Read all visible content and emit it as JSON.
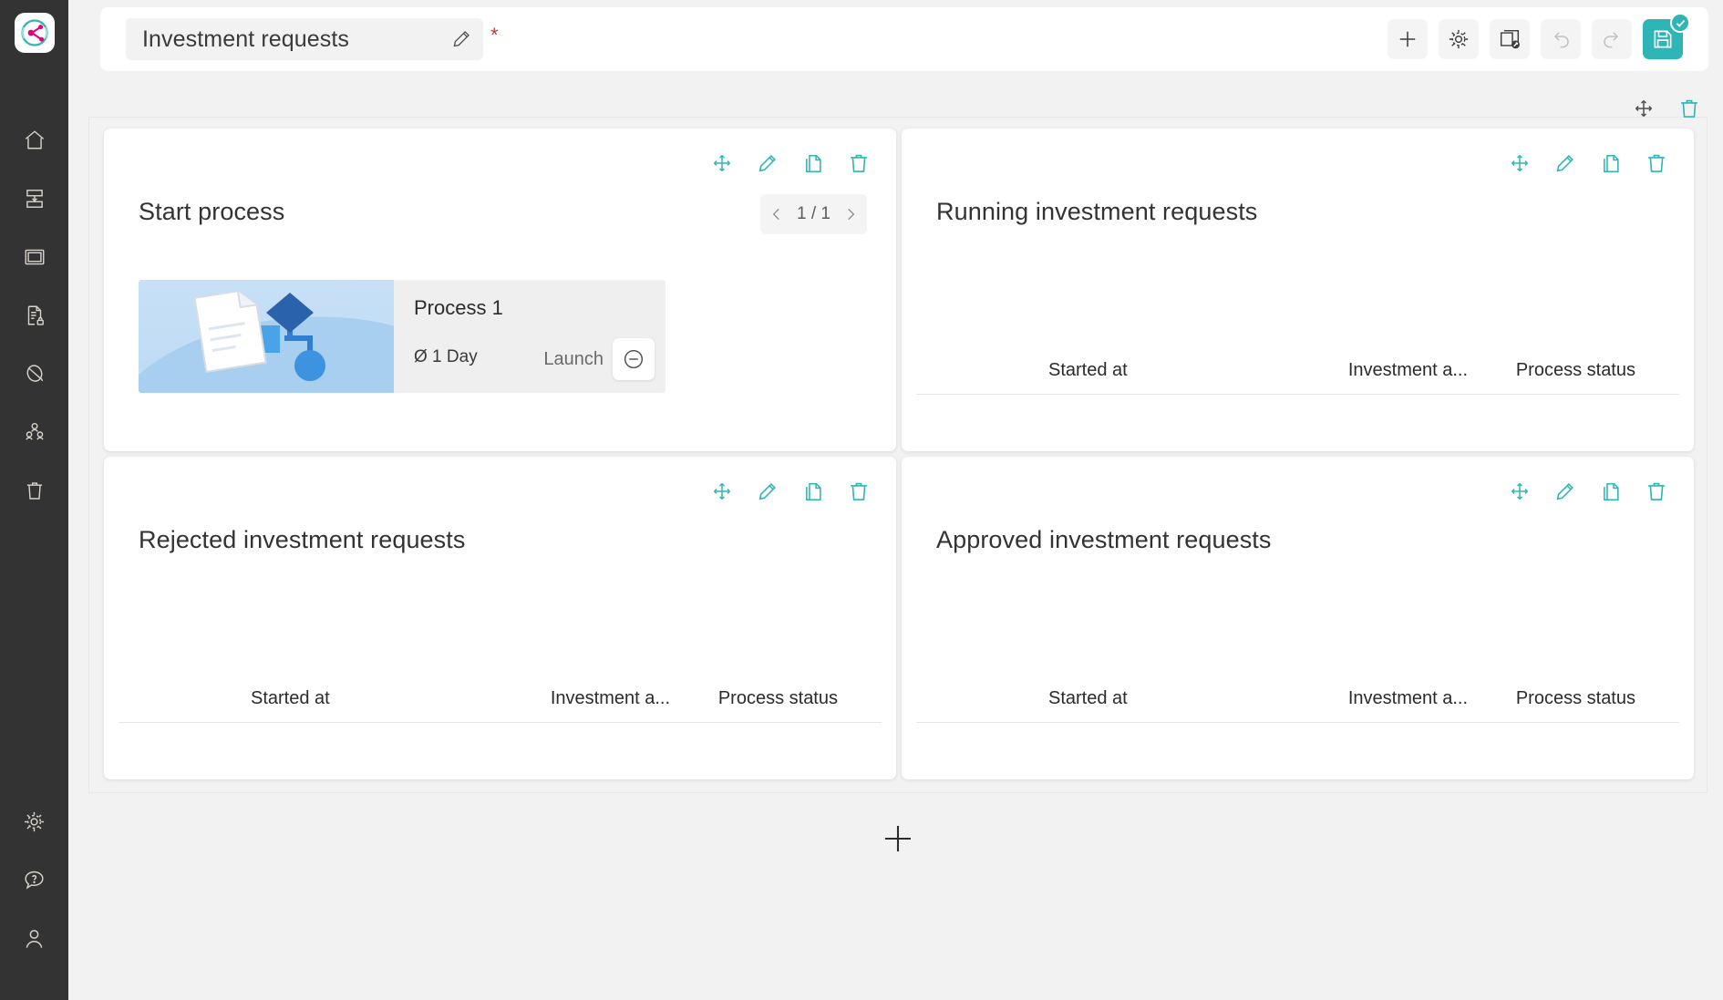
{
  "app": {
    "logo_icon": "app-logo-icon"
  },
  "sidebar": {
    "top_items": [
      {
        "icon": "home-icon",
        "name": "sidebar-item-home"
      },
      {
        "icon": "process-import-icon",
        "name": "sidebar-item-processes"
      },
      {
        "icon": "window-icon",
        "name": "sidebar-item-applications"
      },
      {
        "icon": "document-lock-icon",
        "name": "sidebar-item-documents"
      },
      {
        "icon": "tag-icon",
        "name": "sidebar-item-tags"
      },
      {
        "icon": "users-group-icon",
        "name": "sidebar-item-organization"
      },
      {
        "icon": "trash-icon",
        "name": "sidebar-item-recycle-bin"
      }
    ],
    "bottom_items": [
      {
        "icon": "gear-icon",
        "name": "sidebar-item-settings"
      },
      {
        "icon": "help-bubble-icon",
        "name": "sidebar-item-help"
      },
      {
        "icon": "user-icon",
        "name": "sidebar-item-account"
      }
    ]
  },
  "header": {
    "title_value": "Investment requests",
    "title_placeholder": "Investment requests",
    "edit_icon": "pencil-icon",
    "required_marker": "*",
    "toolbar": [
      {
        "name": "add-button",
        "icon": "plus-icon",
        "label": "Add",
        "disabled": false
      },
      {
        "name": "settings-button",
        "icon": "gear-icon",
        "label": "Settings",
        "disabled": false
      },
      {
        "name": "preview-button",
        "icon": "preview-window-icon",
        "label": "Preview",
        "disabled": false
      },
      {
        "name": "undo-button",
        "icon": "undo-icon",
        "label": "Undo",
        "disabled": true
      },
      {
        "name": "redo-button",
        "icon": "redo-icon",
        "label": "Redo",
        "disabled": true
      },
      {
        "name": "save-button",
        "icon": "save-disk-icon",
        "label": "Save",
        "disabled": false
      }
    ]
  },
  "canvas": {
    "tools": [
      {
        "name": "move-section-button",
        "icon": "move-arrows-icon"
      },
      {
        "name": "delete-section-button",
        "icon": "trash-icon"
      }
    ],
    "card_tools": [
      {
        "name": "move-widget-button",
        "icon": "move-arrows-icon"
      },
      {
        "name": "edit-widget-button",
        "icon": "pencil-icon"
      },
      {
        "name": "duplicate-widget-button",
        "icon": "copy-icon"
      },
      {
        "name": "delete-widget-button",
        "icon": "trash-icon"
      }
    ],
    "add_section": {
      "name": "add-section-button",
      "icon": "plus-icon"
    }
  },
  "colors": {
    "accent_teal": "#2fb5b5",
    "rail_bg": "#333333",
    "page_bg": "#f2f2f2",
    "required_red": "#d0342c",
    "brand_pink": "#e6007e",
    "brand_teal": "#2fb5b5"
  },
  "cards": {
    "start_process": {
      "title": "Start process",
      "pager": {
        "prev_icon": "chevron-left-icon",
        "label": "1 / 1",
        "next_icon": "chevron-right-icon"
      },
      "process": {
        "name": "Process 1",
        "duration": "Ø 1 Day",
        "launch_label": "Launch",
        "launch_icon": "minus-circle-icon",
        "thumbnail_icon": "process-diagram-thumbnail"
      }
    },
    "running": {
      "title": "Running investment requests",
      "columns": [
        "Started at",
        "Investment a...",
        "Process status"
      ],
      "rows": []
    },
    "rejected": {
      "title": "Rejected investment requests",
      "columns": [
        "Started at",
        "Investment a...",
        "Process status"
      ],
      "rows": []
    },
    "approved": {
      "title": "Approved investment requests",
      "columns": [
        "Started at",
        "Investment a...",
        "Process status"
      ],
      "rows": []
    }
  }
}
